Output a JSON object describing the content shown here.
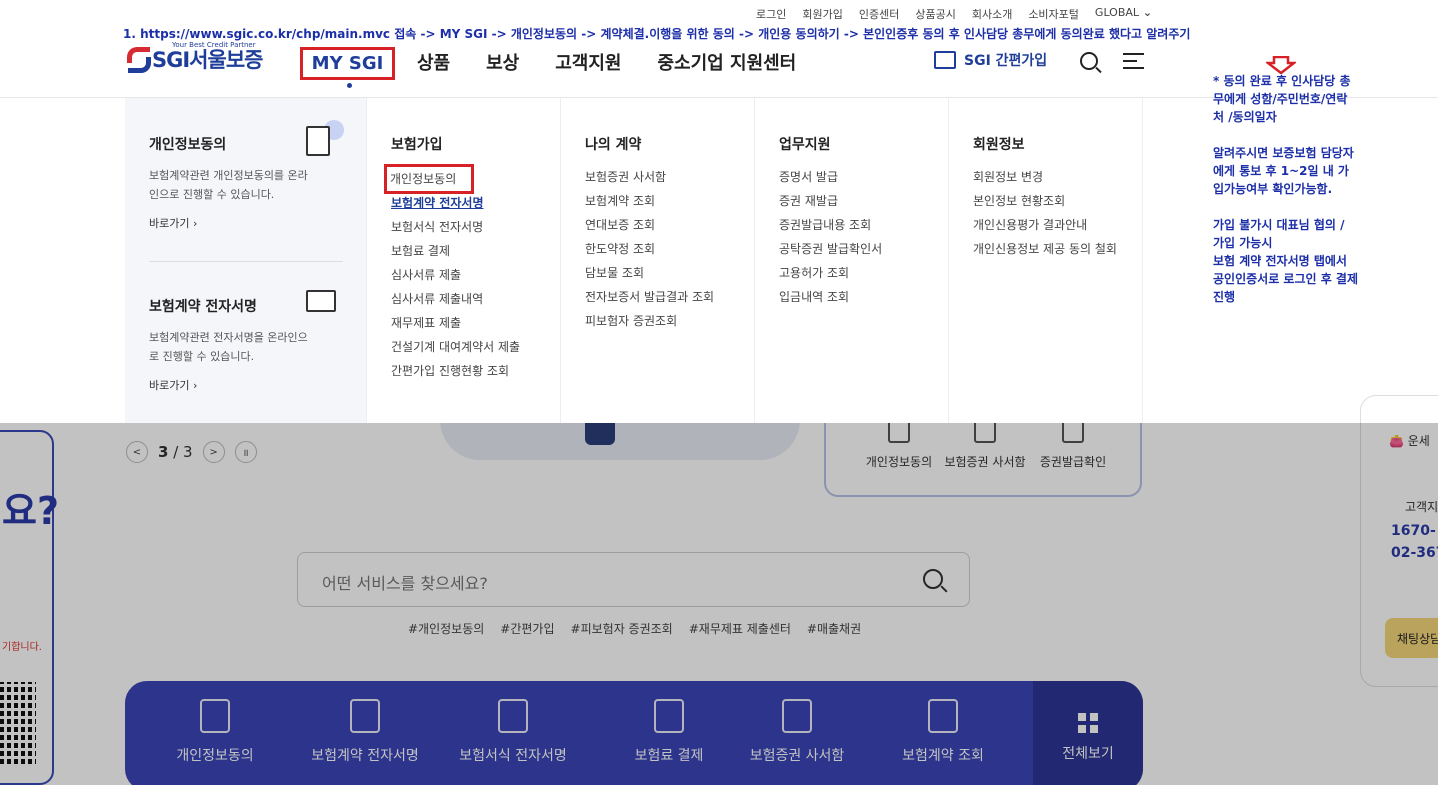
{
  "util_links": [
    "로그인",
    "회원가입",
    "인증센터",
    "상품공시",
    "회사소개",
    "소비자포털",
    "GLOBAL"
  ],
  "annotation_top": "1.  https://www.sgic.co.kr/chp/main.mvc 접속 -> MY SGI -> 개인정보동의 -> 계약체결.이행을 위한 동의 -> 개인용 동의하기 -> 본인인증후 동의 후 인사담당 총무에게 동의완료 했다고 알려주기",
  "annotation_side": "* 동의 완료 후 인사담당 총무에게 성함/주민번호/연락처 /동의일자\n\n알려주시면 보증보험 담당자에게 통보 후 1~2일 내 가입가능여부 확인가능함.\n\n가입 불가시 대표님 협의 / 가입 가능시\n보험 계약 전자서명 탭에서 공인인증서로 로그인 후 결제진행",
  "logo": {
    "text": "SGI서울보증",
    "tagline": "Your Best Credit Partner"
  },
  "gnb": [
    "MY SGI",
    "상품",
    "보상",
    "고객지원",
    "중소기업 지원센터"
  ],
  "easy_join": "SGI 간편가입",
  "promo": [
    {
      "title": "개인정보동의",
      "desc": "보험계약관련 개인정보동의를 온라인으로 진행할 수 있습니다.",
      "link": "바로가기"
    },
    {
      "title": "보험계약 전자서명",
      "desc": "보험계약관련 전자서명을 온라인으로 진행할 수 있습니다.",
      "link": "바로가기"
    }
  ],
  "menu_columns": [
    {
      "title": "보험가입",
      "items": [
        "개인정보동의",
        "보험계약 전자서명",
        "보험서식 전자서명",
        "보험료 결제",
        "심사서류 제출",
        "심사서류 제출내역",
        "재무제표 제출",
        "건설기계 대여계약서 제출",
        "간편가입 진행현황 조회"
      ]
    },
    {
      "title": "나의 계약",
      "items": [
        "보험증권 사서함",
        "보험계약 조회",
        "연대보증 조회",
        "한도약정 조회",
        "담보물 조회",
        "전자보증서 발급결과 조회",
        "피보험자 증권조회"
      ]
    },
    {
      "title": "업무지원",
      "items": [
        "증명서 발급",
        "증권 재발급",
        "증권발급내용 조회",
        "공탁증권 발급확인서",
        "고용허가 조회",
        "입금내역 조회"
      ]
    },
    {
      "title": "회원정보",
      "items": [
        "회원정보 변경",
        "본인정보 현황조회",
        "개인신용평가 결과안내",
        "개인신용정보 제공 동의 철회"
      ]
    }
  ],
  "background": {
    "left_card_text": "요?",
    "left_card_small": "기합니다.",
    "pager": {
      "current": "3",
      "total": "/ 3"
    },
    "quick_items": [
      "개인정보동의",
      "보험증권 사서함",
      "증권발급확인"
    ],
    "right_panel": {
      "top": "운세",
      "label": "고객지",
      "phone1": "1670-",
      "phone2": "02-367",
      "chat": "채팅상담"
    },
    "search_placeholder": "어떤 서비스를 찾으세요?",
    "tags": [
      "#개인정보동의",
      "#간편가입",
      "#피보험자 증권조회",
      "#재무제표 제출센터",
      "#매출채권"
    ],
    "bottom_items": [
      "개인정보동의",
      "보험계약 전자서명",
      "보험서식 전자서명",
      "보험료 결제",
      "보험증권 사서함",
      "보험계약 조회"
    ],
    "view_all": "전체보기"
  },
  "colors": {
    "brand_blue": "#1f3e99",
    "brand_red": "#d62b35",
    "highlight_box": "#d62226",
    "annotation": "#1c2fa8",
    "bottom_bar": "#3a45b8"
  }
}
